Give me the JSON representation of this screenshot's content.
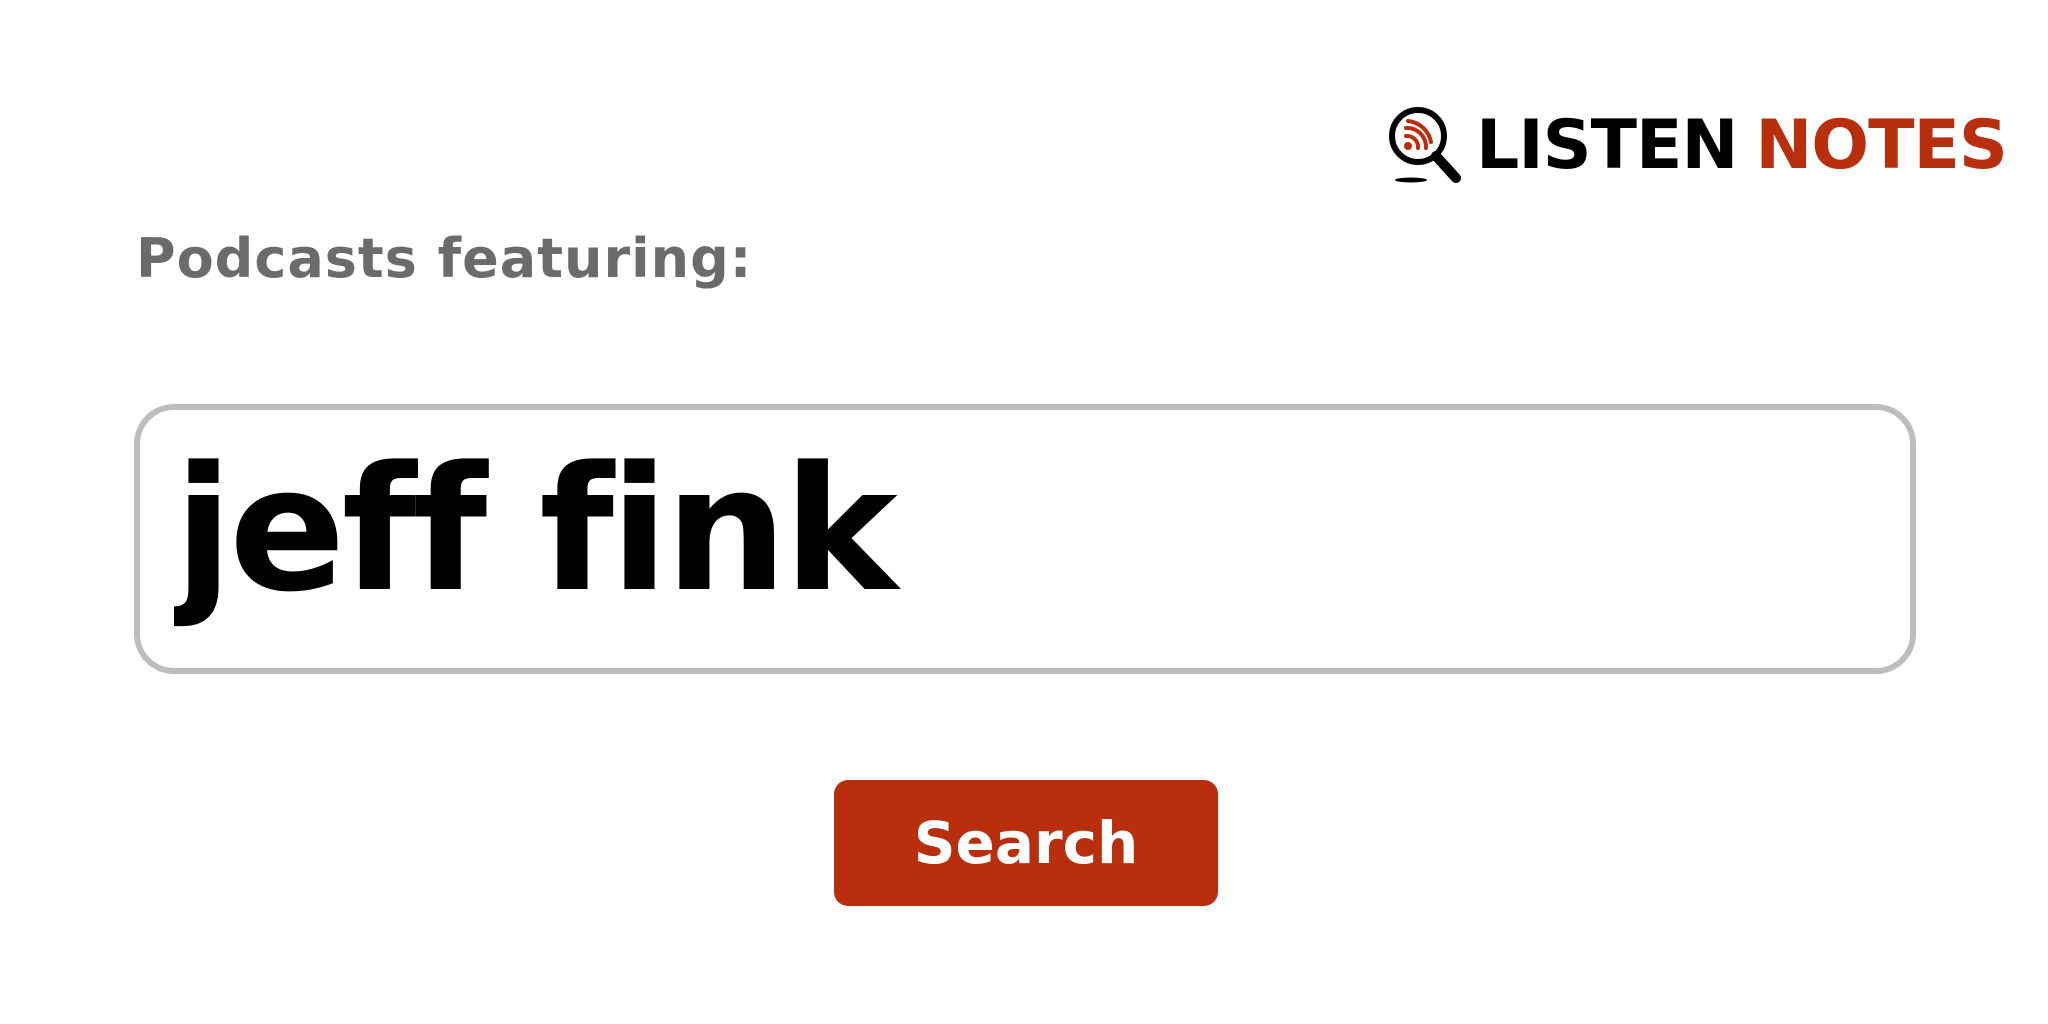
{
  "logo": {
    "word_listen": "LISTEN",
    "word_notes": "NOTES",
    "icon": "magnifier-rss-icon",
    "brand_color": "#b92f0e"
  },
  "heading": "Podcasts featuring:",
  "search": {
    "value": "jeff fink",
    "placeholder": ""
  },
  "button": {
    "label": "Search",
    "color": "#b92f0e"
  }
}
